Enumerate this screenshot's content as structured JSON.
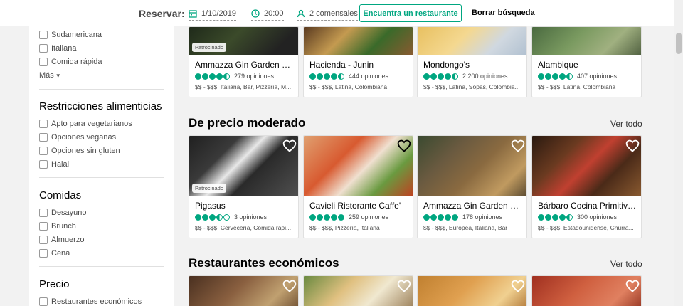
{
  "topbar": {
    "label": "Reservar:",
    "date": "1/10/2019",
    "time": "20:00",
    "guests": "2 comensales",
    "find_button": "Encuentra un restaurante",
    "clear_button": "Borrar búsqueda"
  },
  "sidebar": {
    "cuisine_items": [
      {
        "label": "Sudamericana"
      },
      {
        "label": "Italiana"
      },
      {
        "label": "Comida rápida"
      }
    ],
    "more": "Más",
    "diet_heading": "Restricciones alimenticias",
    "diet_items": [
      {
        "label": "Apto para vegetarianos"
      },
      {
        "label": "Opciones veganas"
      },
      {
        "label": "Opciones sin gluten"
      },
      {
        "label": "Halal"
      }
    ],
    "meals_heading": "Comidas",
    "meal_items": [
      {
        "label": "Desayuno"
      },
      {
        "label": "Brunch"
      },
      {
        "label": "Almuerzo"
      },
      {
        "label": "Cena"
      }
    ],
    "price_heading": "Precio",
    "price_items": [
      {
        "label": "Restaurantes económicos"
      }
    ]
  },
  "top_row": [
    {
      "name": "Ammazza Gin Garden Se...",
      "reviews": "279 opiniones",
      "meta": "$$ - $$$, Italiana, Bar, Pizzería, M...",
      "sponsored": "Patrocinado",
      "rating": 4.5
    },
    {
      "name": "Hacienda - Junin",
      "reviews": "444 opiniones",
      "meta": "$$ - $$$, Latina, Colombiana",
      "rating": 4.5
    },
    {
      "name": "Mondongo's",
      "reviews": "2.200 opiniones",
      "meta": "$$ - $$$, Latina, Sopas, Colombia...",
      "rating": 4.5
    },
    {
      "name": "Alambique",
      "reviews": "407 opiniones",
      "meta": "$$ - $$$, Latina, Colombiana",
      "rating": 4.5
    }
  ],
  "moderate": {
    "title": "De precio moderado",
    "see_all": "Ver todo",
    "cards": [
      {
        "name": "Pigasus",
        "reviews": "3 opiniones",
        "meta": "$$ - $$$, Cervecería, Comida rápi...",
        "sponsored": "Patrocinado",
        "rating": 3.5
      },
      {
        "name": "Cavieli Ristorante Caffe'",
        "reviews": "259 opiniones",
        "meta": "$$ - $$$, Pizzería, Italiana",
        "rating": 5
      },
      {
        "name": "Ammazza Gin Garden Se...",
        "reviews": "178 opiniones",
        "meta": "$$ - $$$, Europea, Italiana, Bar",
        "rating": 5
      },
      {
        "name": "Bárbaro Cocina Primitiva ...",
        "reviews": "300 opiniones",
        "meta": "$$ - $$$, Estadounidense, Churra...",
        "rating": 4.5
      }
    ]
  },
  "cheap": {
    "title": "Restaurantes económicos",
    "see_all": "Ver todo"
  }
}
